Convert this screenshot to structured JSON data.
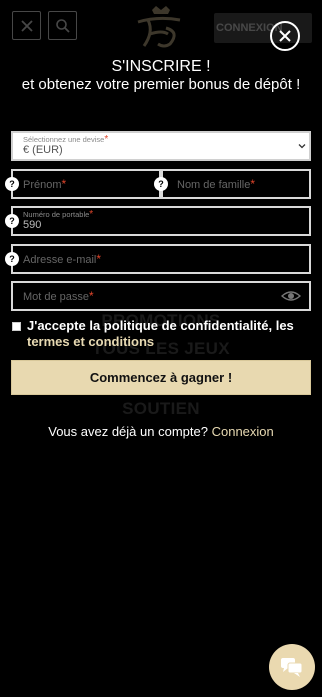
{
  "header": {
    "connexion_label": "CONNEXION",
    "icons": [
      "close-icon",
      "search-icon",
      "logo"
    ]
  },
  "background_menu": {
    "items": [
      "PROMOTIONS",
      "TOUS LES JEUX",
      "SOUTIEN"
    ]
  },
  "modal": {
    "close_icon": "close-circle-icon",
    "title": "S'INSCRIRE !",
    "subtitle": "et obtenez votre premier bonus de dépôt !",
    "currency": {
      "label": "Sélectionnez une devise",
      "value": "€ (EUR)"
    },
    "first_name": {
      "placeholder": "Prénom"
    },
    "last_name": {
      "placeholder": "Nom de famille"
    },
    "phone": {
      "label": "Numéro de portable",
      "value": "590"
    },
    "email": {
      "placeholder": "Adresse e-mail"
    },
    "password": {
      "placeholder": "Mot de passe"
    },
    "required_marker": "*",
    "help_glyph": "?",
    "consent": {
      "text": "J'accepte la politique de confidentialité, les ",
      "terms_link": "termes et conditions",
      "checked": false
    },
    "submit_label": "Commencez à gagner !",
    "login_prompt": "Vous avez déjà un compte?",
    "login_link": "Connexion"
  },
  "colors": {
    "background": "#000000",
    "accent_gold": "#e8d9b0",
    "required_red": "#e0452b",
    "link_gold": "#e7d9b2"
  },
  "chat": {
    "icon": "chat-bubble-icon"
  }
}
